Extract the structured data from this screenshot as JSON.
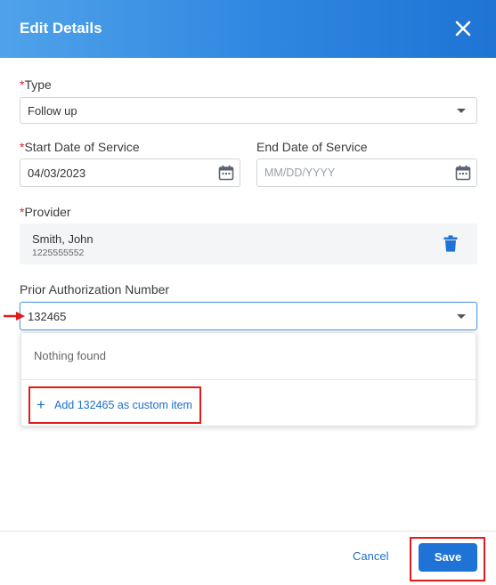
{
  "dialog": {
    "title": "Edit Details"
  },
  "form": {
    "type": {
      "required_mark": "*",
      "label": "Type",
      "value": "Follow up"
    },
    "start_date": {
      "required_mark": "*",
      "label": "Start Date of Service",
      "value": "04/03/2023"
    },
    "end_date": {
      "label": "End Date of Service",
      "placeholder": "MM/DD/YYYY"
    },
    "provider": {
      "required_mark": "*",
      "label": "Provider",
      "name": "Smith, John",
      "npi": "1225555552"
    },
    "prior_auth": {
      "label": "Prior Authorization Number",
      "value": "132465",
      "dropdown": {
        "empty_text": "Nothing found",
        "add_custom_label": "Add 132465 as custom item"
      }
    }
  },
  "footer": {
    "cancel_label": "Cancel",
    "save_label": "Save"
  },
  "colors": {
    "header_gradient_start": "#4fa2ea",
    "header_gradient_end": "#1f74d4",
    "primary": "#1f73d6",
    "link": "#1e6fc9",
    "required": "#e0212b",
    "annotation_red": "#e01b1b"
  },
  "icons": {
    "close": "close-icon",
    "calendar": "calendar-icon",
    "trash": "trash-icon",
    "caret": "chevron-down-icon",
    "plus": "plus-icon",
    "annotation_arrow": "arrow-right-icon"
  }
}
